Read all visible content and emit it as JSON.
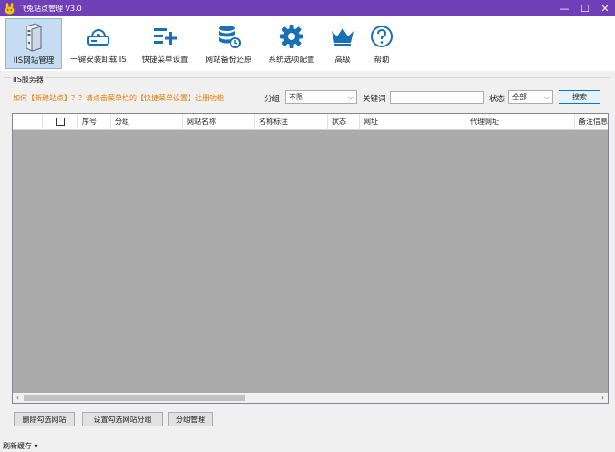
{
  "window": {
    "title": "飞兔站点管理 V3.0",
    "minimize": "—",
    "maximize": "☐",
    "close": "✕"
  },
  "toolbar": {
    "items": [
      {
        "label": "IIS网站管理",
        "icon": "server-icon"
      },
      {
        "label": "一键安装卸载IIS",
        "icon": "hard-drive-icon"
      },
      {
        "label": "快捷菜单设置",
        "icon": "menu-add-icon"
      },
      {
        "label": "网站备份还原",
        "icon": "database-icon"
      },
      {
        "label": "系统选项配置",
        "icon": "gear-icon"
      },
      {
        "label": "高级",
        "icon": "crown-icon"
      },
      {
        "label": "帮助",
        "icon": "help-icon"
      }
    ]
  },
  "section": {
    "label": "IIS服务器"
  },
  "hint": "如何【新建站点】？？请点击菜单栏的【快捷菜单设置】注册功能",
  "filters": {
    "group_label": "分组",
    "group_value": "不限",
    "keyword_label": "关键词",
    "keyword_value": "",
    "status_label": "状态",
    "status_value": "全部",
    "search_button": "搜索"
  },
  "table": {
    "columns": [
      "",
      "",
      "序号",
      "分组",
      "网站名称",
      "名称标注",
      "状态",
      "网址",
      "代理网址",
      "备注信息"
    ]
  },
  "actions": {
    "delete_button": "删除勾选网站",
    "set_group_button": "设置勾选网站分组",
    "group_manage_button": "分组管理"
  },
  "status": {
    "text": "刷新缓存 ▾"
  },
  "colors": {
    "titlebar": "#6f3fb7",
    "icon_blue": "#1a6fb5",
    "hint": "#e07b00",
    "active_tab": "#c5dcf2"
  }
}
